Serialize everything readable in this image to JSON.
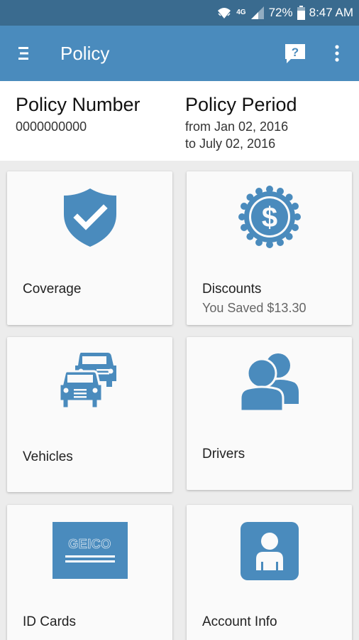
{
  "status": {
    "network": "4G",
    "battery": "72%",
    "time": "8:47 AM"
  },
  "appbar": {
    "title": "Policy"
  },
  "policy": {
    "number_label": "Policy Number",
    "number_value": "0000000000",
    "period_label": "Policy Period",
    "period_from": "from Jan 02, 2016",
    "period_to": "to July 02, 2016"
  },
  "tiles": {
    "coverage": {
      "label": "Coverage",
      "icon": "shield-check-icon"
    },
    "discounts": {
      "label": "Discounts",
      "sub": "You Saved $13.30",
      "icon": "dollar-badge-icon"
    },
    "vehicles": {
      "label": "Vehicles",
      "icon": "cars-icon"
    },
    "drivers": {
      "label": "Drivers",
      "icon": "people-icon"
    },
    "idcards": {
      "label": "ID Cards",
      "icon": "geico-card-icon",
      "card_text": "GEICO"
    },
    "account": {
      "label": "Account Info",
      "icon": "person-badge-icon"
    }
  },
  "colors": {
    "status_bar": "#3a6b8f",
    "app_bar": "#4a8bbd",
    "icon_blue": "#4a8bbd"
  }
}
